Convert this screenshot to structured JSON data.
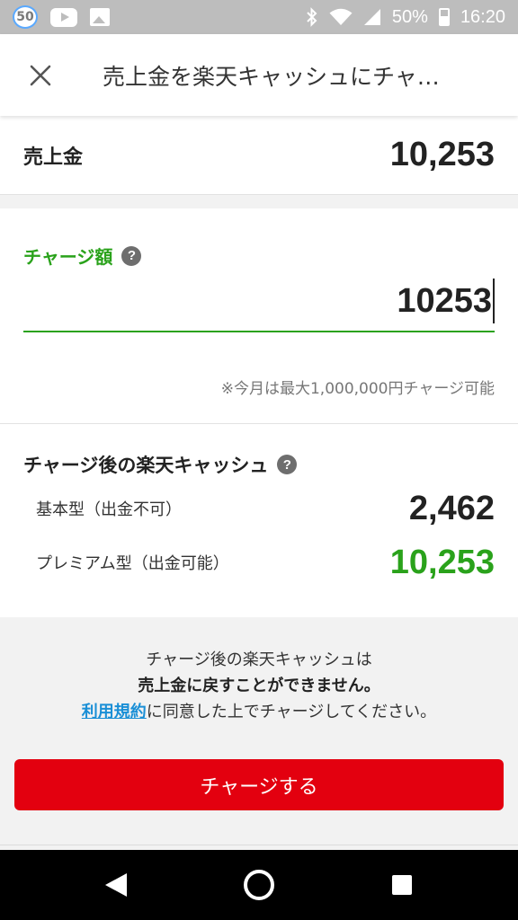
{
  "status_bar": {
    "badge": "50",
    "battery": "50%",
    "time": "16:20"
  },
  "app_bar": {
    "title": "売上金を楽天キャッシュにチャ…"
  },
  "sales": {
    "label": "売上金",
    "value": "10,253"
  },
  "charge": {
    "label": "チャージ額",
    "help": "?",
    "input_value": "10253",
    "note": "※今月は最大1,000,000円チャージ可能"
  },
  "after": {
    "title": "チャージ後の楽天キャッシュ",
    "help": "?",
    "basic_label": "基本型（出金不可）",
    "basic_value": "2,462",
    "premium_label": "プレミアム型（出金可能）",
    "premium_value": "10,253",
    "premium_color": "#2aa21b"
  },
  "info": {
    "line1": "チャージ後の楽天キャッシュは",
    "line2": "売上金に戻すことができません。",
    "terms_link": "利用規約",
    "line3_rest": "に同意した上でチャージしてください。"
  },
  "button": {
    "label": "チャージする",
    "color": "#e3000f"
  },
  "icons": [
    "notification-badge-icon",
    "youtube-icon",
    "image-icon",
    "bluetooth-icon",
    "wifi-icon",
    "signal-icon",
    "battery-icon",
    "close-icon",
    "help-icon",
    "back-icon",
    "home-icon",
    "recents-icon"
  ]
}
